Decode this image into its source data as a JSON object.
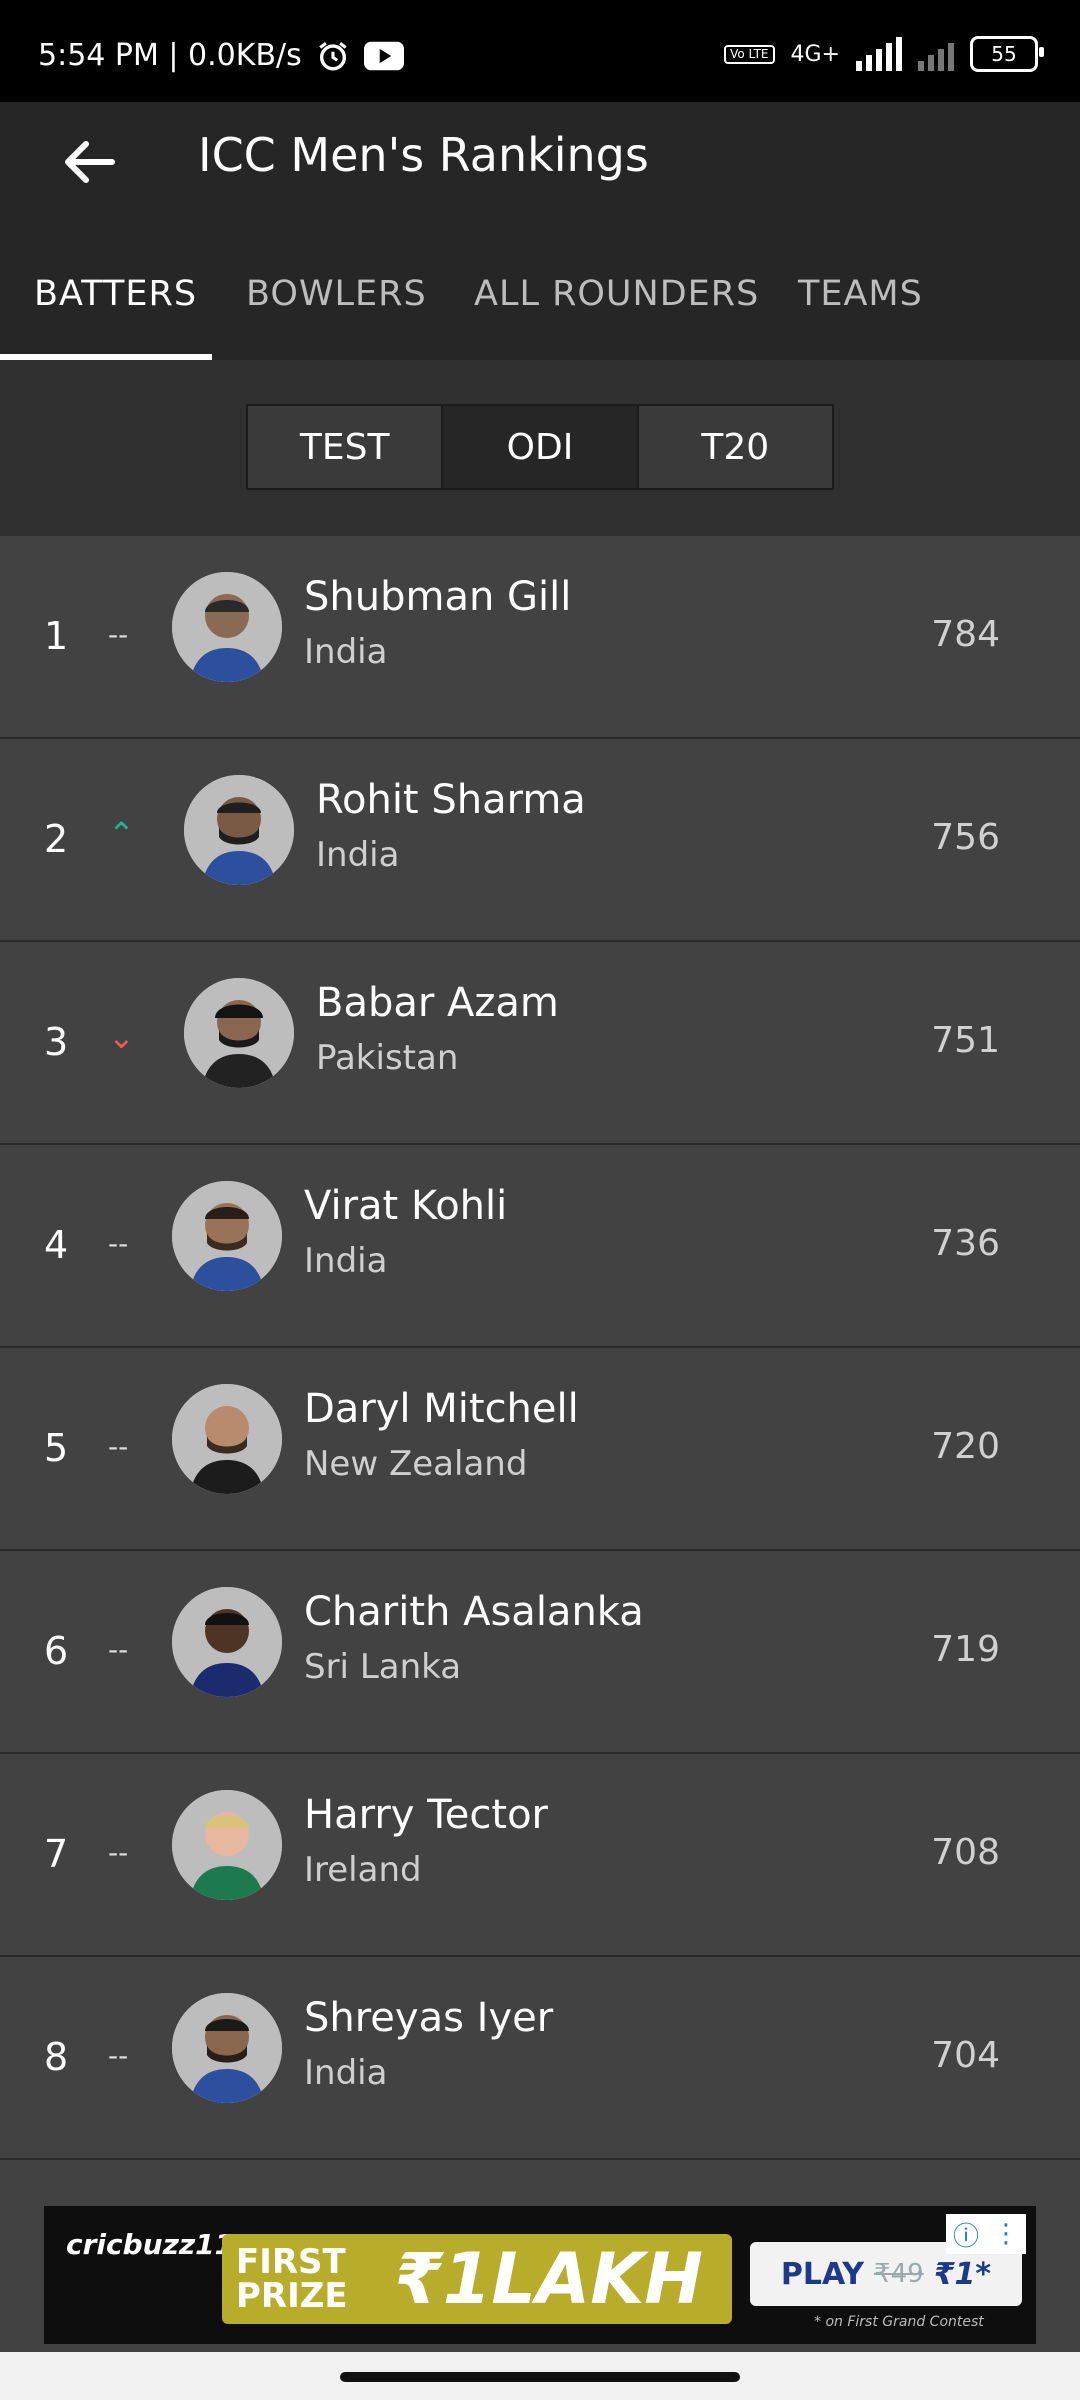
{
  "status_bar": {
    "time_net": "5:54 PM | 0.0KB/s",
    "alarm_icon": "alarm-clock-icon",
    "youtube_icon": "youtube-icon",
    "volte": "Vo LTE",
    "network": "4G+",
    "battery": "55"
  },
  "header": {
    "back_icon": "arrow-left-icon",
    "title": "ICC Men's Rankings"
  },
  "tabs": [
    {
      "label": "BATTERS",
      "active": true
    },
    {
      "label": "BOWLERS",
      "active": false
    },
    {
      "label": "ALL ROUNDERS",
      "active": false
    },
    {
      "label": "TEAMS",
      "active": false
    }
  ],
  "formats": [
    {
      "label": "TEST",
      "active": false
    },
    {
      "label": "ODI",
      "active": true
    },
    {
      "label": "T20",
      "active": false
    }
  ],
  "players": [
    {
      "rank": "1",
      "trend": "--",
      "trend_type": "same",
      "name": "Shubman Gill",
      "country": "India",
      "rating": "784"
    },
    {
      "rank": "2",
      "trend": "⌃",
      "trend_type": "up",
      "name": "Rohit Sharma",
      "country": "India",
      "rating": "756"
    },
    {
      "rank": "3",
      "trend": "⌄",
      "trend_type": "down",
      "name": "Babar Azam",
      "country": "Pakistan",
      "rating": "751"
    },
    {
      "rank": "4",
      "trend": "--",
      "trend_type": "same",
      "name": "Virat Kohli",
      "country": "India",
      "rating": "736"
    },
    {
      "rank": "5",
      "trend": "--",
      "trend_type": "same",
      "name": "Daryl Mitchell",
      "country": "New Zealand",
      "rating": "720"
    },
    {
      "rank": "6",
      "trend": "--",
      "trend_type": "same",
      "name": "Charith Asalanka",
      "country": "Sri Lanka",
      "rating": "719"
    },
    {
      "rank": "7",
      "trend": "--",
      "trend_type": "same",
      "name": "Harry Tector",
      "country": "Ireland",
      "rating": "708"
    },
    {
      "rank": "8",
      "trend": "--",
      "trend_type": "same",
      "name": "Shreyas Iyer",
      "country": "India",
      "rating": "704"
    }
  ],
  "ad": {
    "logo": "cricbuzz11",
    "first_prize": "FIRST PRIZE",
    "amount": "₹1LAKH",
    "play": "PLAY",
    "old_price": "₹49",
    "new_price": "₹1*",
    "note": "* on First Grand Contest"
  },
  "colors": {
    "trend_up": "#1fb58f",
    "trend_down": "#f05a5a"
  }
}
